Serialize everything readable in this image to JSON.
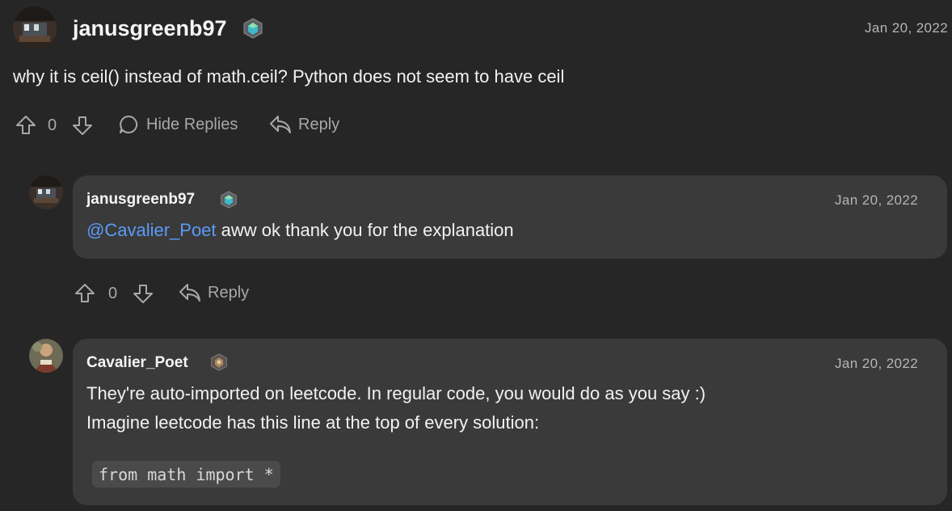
{
  "comment": {
    "username": "janusgreenb97",
    "date": "Jan 20, 2022",
    "body": "why it is ceil() instead of math.ceil? Python does not seem to have ceil",
    "vote_count": "0",
    "hide_replies_label": "Hide Replies",
    "reply_label": "Reply"
  },
  "replies": [
    {
      "username": "janusgreenb97",
      "date": "Jan 20, 2022",
      "mention": "@Cavalier_Poet",
      "body": " aww ok thank you for the explanation",
      "vote_count": "0",
      "reply_label": "Reply"
    },
    {
      "username": "Cavalier_Poet",
      "date": "Jan 20, 2022",
      "line1": "They're auto-imported on leetcode. In regular code, you would do as you say :)",
      "line2": "Imagine leetcode has this line at the top of every solution:",
      "code": "from math import *"
    }
  ],
  "colors": {
    "background": "#262626",
    "bubble": "#3a3a3a",
    "mention": "#5b9bf8",
    "muted_text": "#a8a8a8"
  }
}
